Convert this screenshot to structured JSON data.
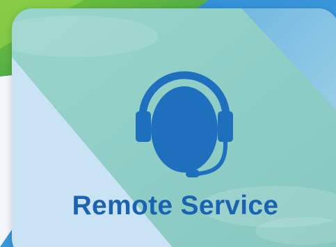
{
  "tile": {
    "label": "Remote Service",
    "icon": "headset-agent-icon"
  },
  "colors": {
    "brand_blue": "#1b63b0",
    "icon_blue": "#1f6fbf",
    "tile_teal": "#8fd0c8",
    "tile_light_blue": "#c9e3f5",
    "bg_green": "#5fb83c",
    "bg_blue": "#2e8bd6"
  }
}
